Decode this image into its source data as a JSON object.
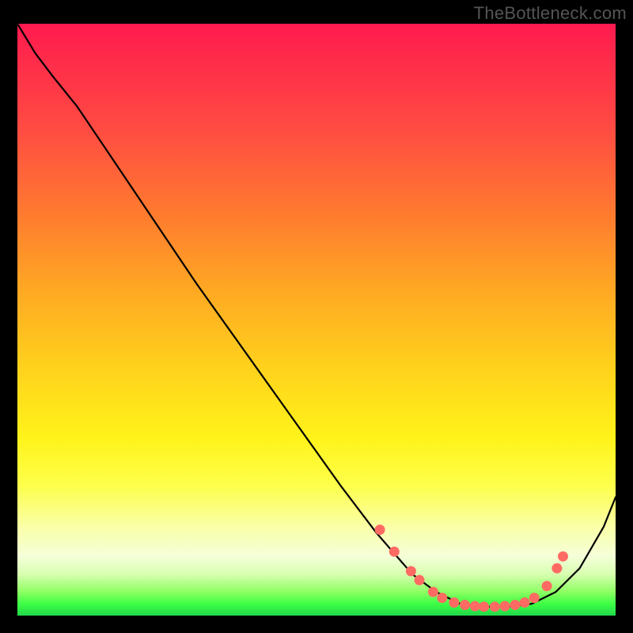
{
  "watermark": "TheBottleneck.com",
  "colors": {
    "background_frame": "#000000",
    "dot_fill": "#ff6b63",
    "curve_stroke": "#000000",
    "watermark_text": "#555555",
    "gradient_stops": [
      {
        "pct": 0,
        "hex": "#ff1a4f"
      },
      {
        "pct": 6,
        "hex": "#ff2b4a"
      },
      {
        "pct": 18,
        "hex": "#ff4c42"
      },
      {
        "pct": 32,
        "hex": "#ff7a2f"
      },
      {
        "pct": 44,
        "hex": "#ffa524"
      },
      {
        "pct": 58,
        "hex": "#ffd11c"
      },
      {
        "pct": 70,
        "hex": "#fff31a"
      },
      {
        "pct": 78,
        "hex": "#fdff4a"
      },
      {
        "pct": 85,
        "hex": "#faffa8"
      },
      {
        "pct": 90,
        "hex": "#f4ffd8"
      },
      {
        "pct": 93,
        "hex": "#d8ffb0"
      },
      {
        "pct": 96,
        "hex": "#8dff63"
      },
      {
        "pct": 98,
        "hex": "#3eff45"
      },
      {
        "pct": 100,
        "hex": "#20d84a"
      }
    ]
  },
  "chart_data": {
    "type": "line",
    "title": "",
    "xlabel": "",
    "ylabel": "",
    "xlim": [
      0,
      1
    ],
    "ylim": [
      0,
      1
    ],
    "grid": false,
    "notes": "Bottleneck curve; background encodes y via color gradient (red high→green low). No visible numeric axes in image; units unknown. x and y are normalized 0–1 from the plot area.",
    "series": [
      {
        "name": "bottleneck-curve",
        "x": [
          0.0,
          0.03,
          0.06,
          0.1,
          0.18,
          0.3,
          0.42,
          0.54,
          0.6,
          0.66,
          0.7,
          0.74,
          0.78,
          0.82,
          0.86,
          0.9,
          0.94,
          0.98,
          1.0
        ],
        "y": [
          1.0,
          0.95,
          0.91,
          0.86,
          0.74,
          0.56,
          0.39,
          0.22,
          0.14,
          0.07,
          0.04,
          0.02,
          0.015,
          0.015,
          0.02,
          0.04,
          0.08,
          0.15,
          0.2
        ]
      }
    ],
    "markers": {
      "name": "highlight-dots",
      "comment": "Salmon scatter points emphasizing flat/rise region.",
      "x": [
        0.606,
        0.63,
        0.658,
        0.672,
        0.695,
        0.71,
        0.73,
        0.748,
        0.765,
        0.78,
        0.798,
        0.815,
        0.832,
        0.848,
        0.864,
        0.885,
        0.902,
        0.912
      ],
      "y": [
        0.145,
        0.108,
        0.075,
        0.06,
        0.04,
        0.03,
        0.022,
        0.018,
        0.016,
        0.015,
        0.015,
        0.016,
        0.018,
        0.022,
        0.03,
        0.05,
        0.08,
        0.1
      ]
    }
  }
}
